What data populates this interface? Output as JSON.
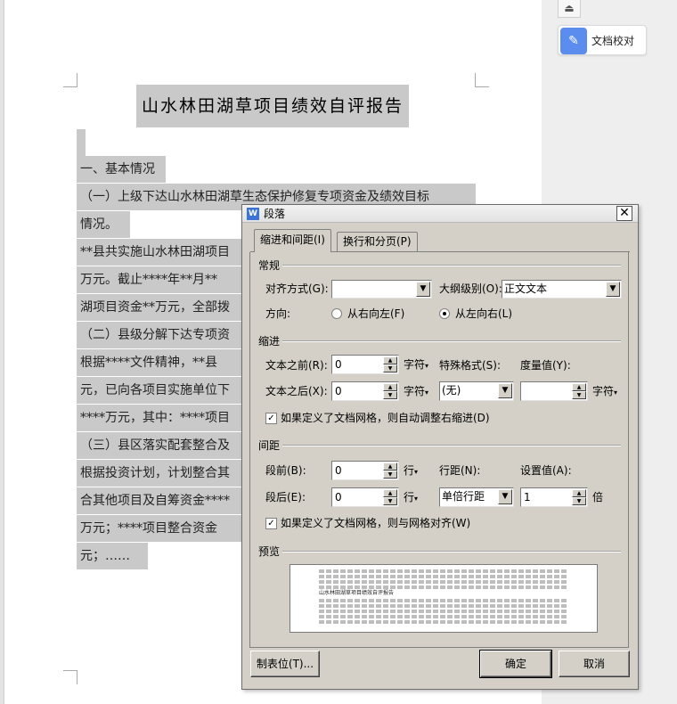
{
  "document": {
    "title": "山水林田湖草项目绩效自评报告",
    "lines": [
      "一、基本情况",
      "（一）上级下达山水林田湖草生态保护修复专项资金及绩效目标",
      "情况。",
      "**县共实施山水林田湖项目",
      "万元。截止****年**月**",
      "湖项目资金**万元，全部拨",
      "（二）县级分解下达专项资",
      "根据****文件精神，**县",
      "元，已向各项目实施单位下",
      "****万元，其中：****项目",
      "（三）县区落实配套整合及",
      "根据投资计划，计划整合其",
      "合其他项目及自筹资金****",
      "万元；****项目整合资金",
      "元；……"
    ]
  },
  "sidebar": {
    "proofread_label": "文档校对"
  },
  "dialog": {
    "title": "段落",
    "close_glyph": "✕",
    "tabs": [
      "缩进和间距(I)",
      "换行和分页(P)"
    ],
    "general": {
      "heading": "常规",
      "align_label": "对齐方式(G):",
      "align_value": "",
      "outline_label": "大纲级别(O):",
      "outline_value": "正文文本",
      "direction_label": "方向:",
      "rtl_label": "从右向左(F)",
      "ltr_label": "从左向右(L)"
    },
    "indent": {
      "heading": "缩进",
      "before_label": "文本之前(R):",
      "before_value": "0",
      "before_unit": "字符",
      "after_label": "文本之后(X):",
      "after_value": "0",
      "after_unit": "字符",
      "special_label": "特殊格式(S):",
      "special_value": "(无)",
      "measure_label": "度量值(Y):",
      "measure_value": "",
      "measure_unit": "字符",
      "grid_check_label": "如果定义了文档网格，则自动调整右缩进(D)"
    },
    "spacing": {
      "heading": "间距",
      "before_label": "段前(B):",
      "before_value": "0",
      "before_unit": "行",
      "after_label": "段后(E):",
      "after_value": "0",
      "after_unit": "行",
      "line_label": "行距(N):",
      "line_value": "单倍行距",
      "setting_label": "设置值(A):",
      "setting_value": "1",
      "setting_unit": "倍",
      "grid_check_label": "如果定义了文档网格，则与网格对齐(W)"
    },
    "preview": {
      "heading": "预览",
      "sample_text": "山水林田湖草项目绩效自评报告"
    },
    "buttons": {
      "tabs_button": "制表位(T)...",
      "ok": "确定",
      "cancel": "取消"
    }
  },
  "colors": {
    "highlight": "#e8192c",
    "selection": "#c9c9c9",
    "dialog_bg": "#d4d0c8"
  }
}
